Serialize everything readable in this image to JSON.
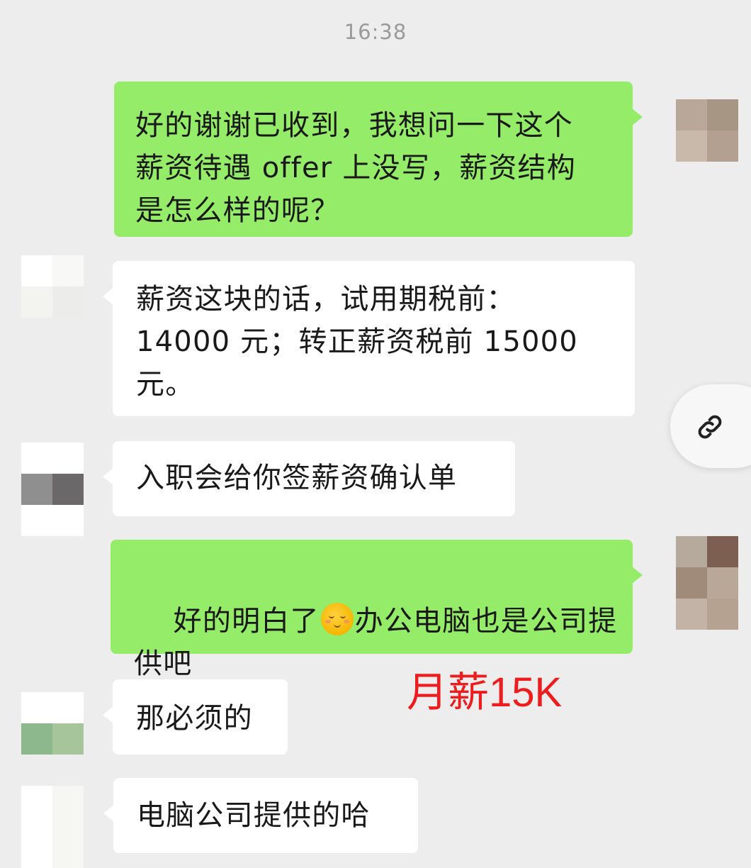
{
  "timestamp": "16:38",
  "messages": [
    {
      "sender": "me",
      "text": "好的谢谢已收到，我想问一下这个\n薪资待遇 offer 上没写，薪资结构\n是怎么样的呢？"
    },
    {
      "sender": "them",
      "text": "薪资这块的话，试用期税前：\n14000 元；转正薪资税前 15000\n元。"
    },
    {
      "sender": "them",
      "text": "入职会给你签薪资确认单"
    },
    {
      "sender": "me",
      "text_before_emoji": "好的明白了",
      "emoji": "blushing-smile-emoji",
      "text_after_emoji": "办公电脑也是公司提\n供吧"
    },
    {
      "sender": "them",
      "text": "那必须的"
    },
    {
      "sender": "them",
      "text": "电脑公司提供的哈"
    }
  ],
  "annotation": {
    "text": "月薪15K",
    "color": "#ee1d1d"
  },
  "link_button": {
    "icon": "link-icon"
  },
  "colors": {
    "background": "#ededed",
    "my_bubble": "#95ec69",
    "their_bubble": "#ffffff",
    "timestamp": "#9a9a9a"
  }
}
